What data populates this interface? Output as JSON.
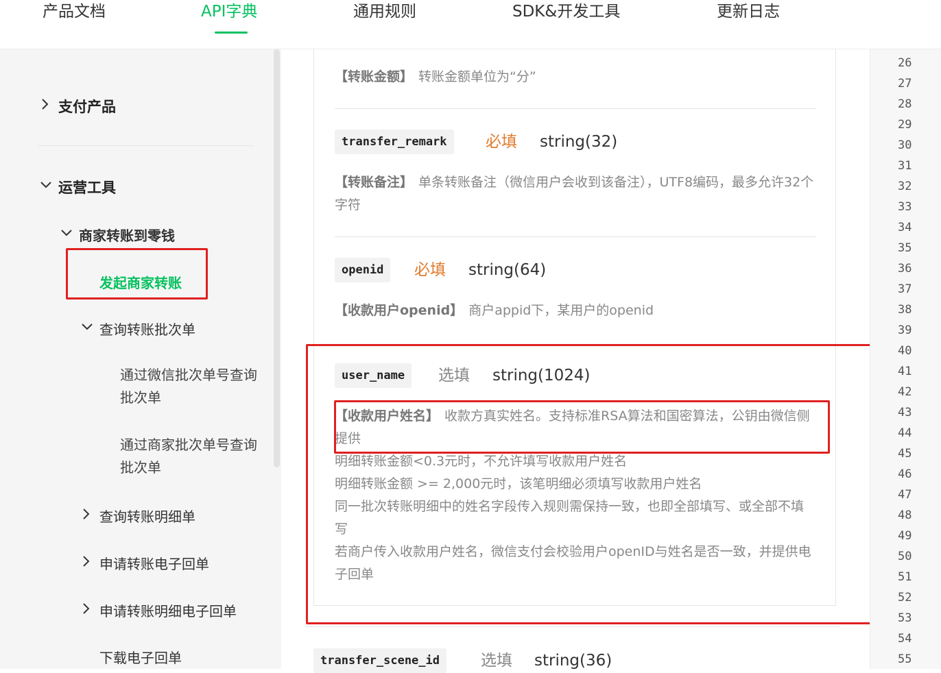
{
  "topnav": {
    "tabs": [
      {
        "label": "产品文档"
      },
      {
        "label": "API字典"
      },
      {
        "label": "通用规则"
      },
      {
        "label": "SDK&开发工具"
      },
      {
        "label": "更新日志"
      }
    ],
    "active_tab": "API字典"
  },
  "sidebar": {
    "items": [
      {
        "label": "支付产品"
      },
      {
        "label": "运营工具"
      },
      {
        "label": "商家转账到零钱"
      },
      {
        "label": "发起商家转账"
      },
      {
        "label": "查询转账批次单"
      },
      {
        "label": "通过微信批次单号查询批次单"
      },
      {
        "label": "通过商家批次单号查询批次单"
      },
      {
        "label": "查询转账明细单"
      },
      {
        "label": "申请转账电子回单"
      },
      {
        "label": "申请转账明细电子回单"
      },
      {
        "label": "下载电子回单"
      }
    ],
    "active_item": "发起商家转账"
  },
  "content": {
    "transfer_amount": {
      "title": "【转账金额】",
      "text": "转账金额单位为“分”"
    },
    "transfer_remark": {
      "name": "transfer_remark",
      "required": "必填",
      "type": "string(32)",
      "title": "【转账备注】",
      "text": "单条转账备注（微信用户会收到该备注），UTF8编码，最多允许32个字符"
    },
    "openid": {
      "name": "openid",
      "required": "必填",
      "type": "string(64)",
      "title": "【收款用户openid】",
      "text": "商户appid下，某用户的openid"
    },
    "user_name": {
      "name": "user_name",
      "required": "选填",
      "type": "string(1024)",
      "title": "【收款用户姓名】",
      "text": "收款方真实姓名。支持标准RSA算法和国密算法，公钥由微信侧提供",
      "notes": [
        "明细转账金额<0.3元时，不允许填写收款用户姓名",
        "明细转账金额 >= 2,000元时，该笔明细必须填写收款用户姓名",
        "同一批次转账明细中的姓名字段传入规则需保持一致，也即全部填写、或全部不填写",
        "若商户传入收款用户姓名，微信支付会校验用户openID与姓名是否一致，并提供电子回单"
      ]
    },
    "transfer_scene_id": {
      "name": "transfer_scene_id",
      "required": "选填",
      "type": "string(36)"
    }
  },
  "gutter": {
    "line_numbers": [
      "26",
      "27",
      "28",
      "29",
      "30",
      "31",
      "32",
      "33",
      "34",
      "35",
      "36",
      "37",
      "38",
      "39",
      "40",
      "41",
      "42",
      "43",
      "44",
      "45",
      "46",
      "47",
      "48",
      "49",
      "50",
      "51",
      "52",
      "53",
      "54",
      "55"
    ]
  },
  "colors": {
    "accent": "#07c160",
    "required": "#e07b2d",
    "highlight_box": "#e02020"
  }
}
